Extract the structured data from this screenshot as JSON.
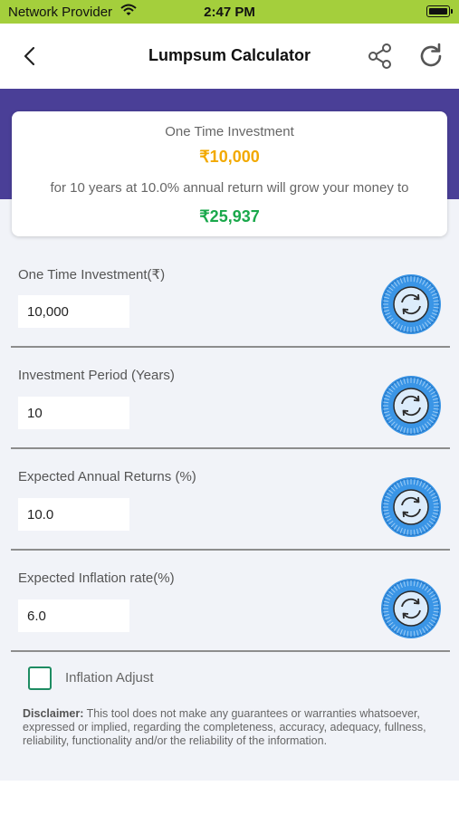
{
  "status_bar": {
    "carrier": "Network Provider",
    "time": "2:47 PM"
  },
  "nav": {
    "title": "Lumpsum Calculator"
  },
  "summary": {
    "label": "One Time Investment",
    "amount": "₹10,000",
    "description": "for 10 years at 10.0% annual return will grow your money to",
    "result": "₹25,937"
  },
  "fields": [
    {
      "label": "One Time Investment(₹)",
      "value": "10,000"
    },
    {
      "label": "Investment Period (Years)",
      "value": "10"
    },
    {
      "label": "Expected Annual Returns (%)",
      "value": "10.0"
    },
    {
      "label": "Expected Inflation rate(%)",
      "value": "6.0"
    }
  ],
  "inflation_adjust": {
    "label": "Inflation Adjust",
    "checked": false
  },
  "disclaimer": {
    "heading": "Disclaimer:",
    "text": " This tool does not make any guarantees or warranties whatsoever, expressed or implied, regarding the completeness, accuracy, adequacy, fullness, reliability, functionality and/or the reliability of the information."
  },
  "colors": {
    "status_bar": "#a4cf3c",
    "header_band": "#4a3f97",
    "amount": "#f2a900",
    "result": "#1aa84b",
    "dial": "#3a95e6",
    "checkbox": "#1e8c62"
  },
  "icons": {
    "back": "chevron-left-icon",
    "share": "share-icon",
    "refresh": "refresh-icon",
    "dial": "rotary-dial-icon",
    "wifi": "wifi-icon",
    "battery": "battery-icon"
  }
}
